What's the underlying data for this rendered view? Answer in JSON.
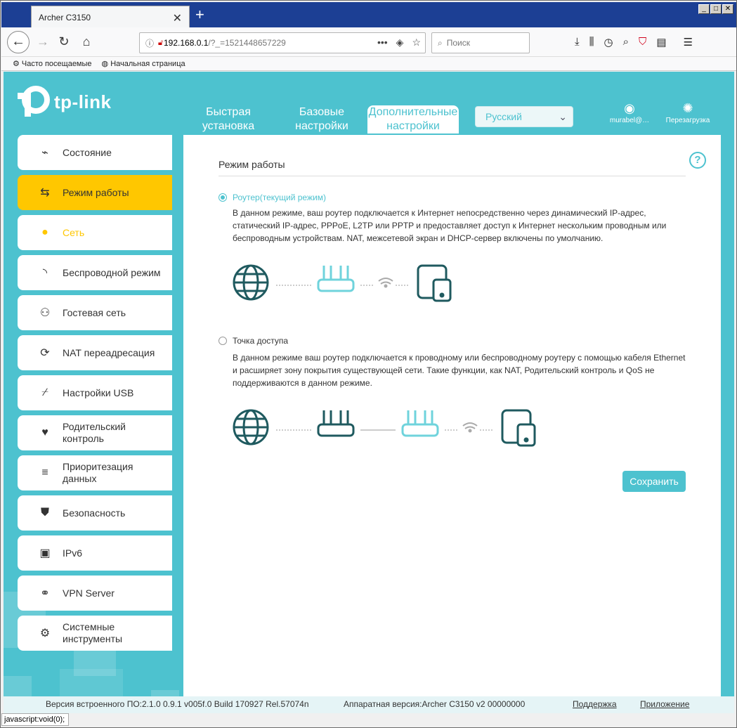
{
  "browser": {
    "tab_title": "Archer C3150",
    "tab_close": "✕",
    "new_tab": "+",
    "url_host": "192.168.0.1",
    "url_path": "/?_=1521448657229",
    "search_placeholder": "Поиск",
    "bookmarks": [
      "Часто посещаемые",
      "Начальная страница"
    ],
    "window_buttons": [
      "_",
      "□",
      "✕"
    ],
    "url_menu": "•••",
    "status_text": "javascript:void(0);"
  },
  "header": {
    "logo_text": "tp-link",
    "nav": [
      {
        "label": "Быстрая\nустановка"
      },
      {
        "label": "Базовые\nнастройки"
      },
      {
        "label": "Дополнительные\nнастройки"
      }
    ],
    "language": "Русский",
    "user_label": "murabel@…",
    "reboot_label": "Перезагрузка"
  },
  "sidebar": {
    "items": [
      {
        "label": "Состояние",
        "icon": "pulse-icon"
      },
      {
        "label": "Режим работы",
        "icon": "swap-icon"
      },
      {
        "label": "Сеть",
        "icon": "globe-icon"
      },
      {
        "label": "Беспроводной режим",
        "icon": "wifi-icon"
      },
      {
        "label": "Гостевая сеть",
        "icon": "users-icon"
      },
      {
        "label": "NAT переадресация",
        "icon": "nat-icon"
      },
      {
        "label": "Настройки USB",
        "icon": "usb-icon"
      },
      {
        "label": "Родительский\nконтроль",
        "icon": "family-icon"
      },
      {
        "label": "Приоритезация\nданных",
        "icon": "priority-icon"
      },
      {
        "label": "Безопасность",
        "icon": "shield-icon"
      },
      {
        "label": "IPv6",
        "icon": "ipv6-icon"
      },
      {
        "label": "VPN Server",
        "icon": "link-icon"
      },
      {
        "label": "Системные\nинструменты",
        "icon": "gear-icon"
      }
    ]
  },
  "main": {
    "title": "Режим работы",
    "help": "?",
    "modes": [
      {
        "label": "Роутер(текущий режим)",
        "selected": true,
        "description": "В данном режиме, ваш роутер подключается к Интернет непосредственно через динамический IP-адрес, статический IP-адрес, PPPoE, L2TP или PPTP и предоставляет доступ к Интернет нескольким проводным или беспроводным устройствам. NAT, межсетевой экран и DHCP-сервер включены по умолчанию."
      },
      {
        "label": "Точка доступа",
        "selected": false,
        "description": "В данном режиме ваш роутер подключается к проводному или беспроводному роутеру с помощью кабеля Ethernet и расширяет зону покрытия существующей сети. Такие функции, как NAT, Родительский контроль и QoS не поддерживаются в данном режиме."
      }
    ],
    "save_label": "Сохранить"
  },
  "footer": {
    "firmware": "Версия встроенного ПО:2.1.0 0.9.1 v005f.0 Build 170927 Rel.57074n",
    "hardware": "Аппаратная версия:Archer C3150 v2 00000000",
    "support": "Поддержка",
    "app": "Приложение"
  },
  "colors": {
    "accent": "#4dc2cf",
    "active": "#ffc700",
    "dark_icon": "#1f5a5f"
  }
}
